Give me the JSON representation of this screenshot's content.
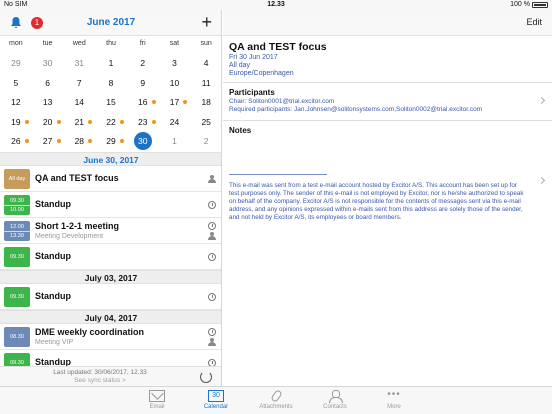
{
  "status_bar": {
    "carrier": "No SIM",
    "time": "12.33",
    "battery": "100 %"
  },
  "calendar": {
    "notifications_count": "1",
    "month_title": "June 2017",
    "weekdays": [
      "mon",
      "tue",
      "wed",
      "thu",
      "fri",
      "sat",
      "sun"
    ],
    "weeks": [
      [
        {
          "d": "29",
          "muted": true,
          "dot": false
        },
        {
          "d": "30",
          "muted": true,
          "dot": false
        },
        {
          "d": "31",
          "muted": true,
          "dot": false
        },
        {
          "d": "1",
          "muted": false,
          "dot": false
        },
        {
          "d": "2",
          "muted": false,
          "dot": false
        },
        {
          "d": "3",
          "muted": false,
          "dot": false
        },
        {
          "d": "4",
          "muted": false,
          "dot": false
        }
      ],
      [
        {
          "d": "5",
          "muted": false,
          "dot": false
        },
        {
          "d": "6",
          "muted": false,
          "dot": false
        },
        {
          "d": "7",
          "muted": false,
          "dot": false
        },
        {
          "d": "8",
          "muted": false,
          "dot": false
        },
        {
          "d": "9",
          "muted": false,
          "dot": false
        },
        {
          "d": "10",
          "muted": false,
          "dot": false
        },
        {
          "d": "11",
          "muted": false,
          "dot": false
        }
      ],
      [
        {
          "d": "12",
          "muted": false,
          "dot": false
        },
        {
          "d": "13",
          "muted": false,
          "dot": false
        },
        {
          "d": "14",
          "muted": false,
          "dot": false
        },
        {
          "d": "15",
          "muted": false,
          "dot": false
        },
        {
          "d": "16",
          "muted": false,
          "dot": true
        },
        {
          "d": "17",
          "muted": false,
          "dot": true
        },
        {
          "d": "18",
          "muted": false,
          "dot": false
        }
      ],
      [
        {
          "d": "19",
          "muted": false,
          "dot": true
        },
        {
          "d": "20",
          "muted": false,
          "dot": true
        },
        {
          "d": "21",
          "muted": false,
          "dot": true
        },
        {
          "d": "22",
          "muted": false,
          "dot": true
        },
        {
          "d": "23",
          "muted": false,
          "dot": true
        },
        {
          "d": "24",
          "muted": false,
          "dot": false
        },
        {
          "d": "25",
          "muted": false,
          "dot": false
        }
      ],
      [
        {
          "d": "26",
          "muted": false,
          "dot": true
        },
        {
          "d": "27",
          "muted": false,
          "dot": true
        },
        {
          "d": "28",
          "muted": false,
          "dot": true
        },
        {
          "d": "29",
          "muted": false,
          "dot": true
        },
        {
          "d": "30",
          "muted": false,
          "dot": false,
          "selected": true
        },
        {
          "d": "1",
          "muted": true,
          "dot": false
        },
        {
          "d": "2",
          "muted": true,
          "dot": false
        }
      ]
    ]
  },
  "agenda": [
    {
      "type": "header",
      "label": "June 30, 2017",
      "blue": true
    },
    {
      "type": "event",
      "chip": "allday",
      "chip_top": "All day",
      "title": "QA and TEST focus",
      "icons": [
        "person"
      ]
    },
    {
      "type": "event",
      "chip": "green",
      "chip_top": "09.30",
      "chip_bottom": "10.00",
      "title": "Standup",
      "icons": [
        "clock"
      ]
    },
    {
      "type": "event",
      "chip": "blue",
      "chip_top": "12.00",
      "chip_bottom": "13.30",
      "title": "Short 1-2-1 meeting",
      "subtitle": "Meeting Development",
      "icons": [
        "clock",
        "person"
      ]
    },
    {
      "type": "event",
      "chip": "green",
      "chip_top": "09.30",
      "title": "Standup",
      "icons": [
        "clock"
      ]
    },
    {
      "type": "header",
      "label": "July 03, 2017",
      "blue": false
    },
    {
      "type": "event",
      "chip": "green",
      "chip_top": "09.30",
      "title": "Standup",
      "icons": [
        "clock"
      ]
    },
    {
      "type": "header",
      "label": "July 04, 2017",
      "blue": false
    },
    {
      "type": "event",
      "chip": "blue",
      "chip_top": "08.30",
      "title": "DME weekly coordination",
      "subtitle": "Meeting VIP",
      "icons": [
        "clock",
        "person"
      ]
    },
    {
      "type": "event",
      "chip": "green",
      "chip_top": "09.30",
      "title": "Standup",
      "icons": [
        "clock"
      ]
    }
  ],
  "footer": {
    "last_updated": "Last updated: 30/06/2017, 12.33",
    "sync_status": "See sync status >"
  },
  "detail": {
    "edit_label": "Edit",
    "title": "QA and TEST focus",
    "date": "Fri 30 Jun 2017",
    "all_day": "All day",
    "timezone": "Europe/Copenhagen",
    "participants_heading": "Participants",
    "chair": "Chair: Soliton0001@trial.excitor.com",
    "required": "Required participants: Jan.Johnsen@solitonsystems.com,Soliton0002@trial.excitor.com",
    "notes_heading": "Notes",
    "notes_text": "This e-mail was sent from a test e-mail account hosted by Excitor A/S. This account has been set up for test purposes only. The sender of this e-mail is not employed by Excitor, nor is he/she authorized to speak on behalf of the company. Excitor A/S is not responsible for the contents of messages sent via this e-mail address, and any opinions expressed within e-mails sent from this address are solely those of the sender, and not held by Excitor A/S, its employees or board members."
  },
  "tabs": [
    {
      "label": "Email",
      "icon": "mail-icon",
      "active": false
    },
    {
      "label": "Calendar",
      "icon": "calendar-icon",
      "active": true,
      "glyph": "30"
    },
    {
      "label": "Attachments",
      "icon": "paperclip-icon",
      "active": false
    },
    {
      "label": "Contacts",
      "icon": "contacts-icon",
      "active": false
    },
    {
      "label": "More",
      "icon": "more-icon",
      "active": false,
      "glyph": "•••"
    }
  ]
}
